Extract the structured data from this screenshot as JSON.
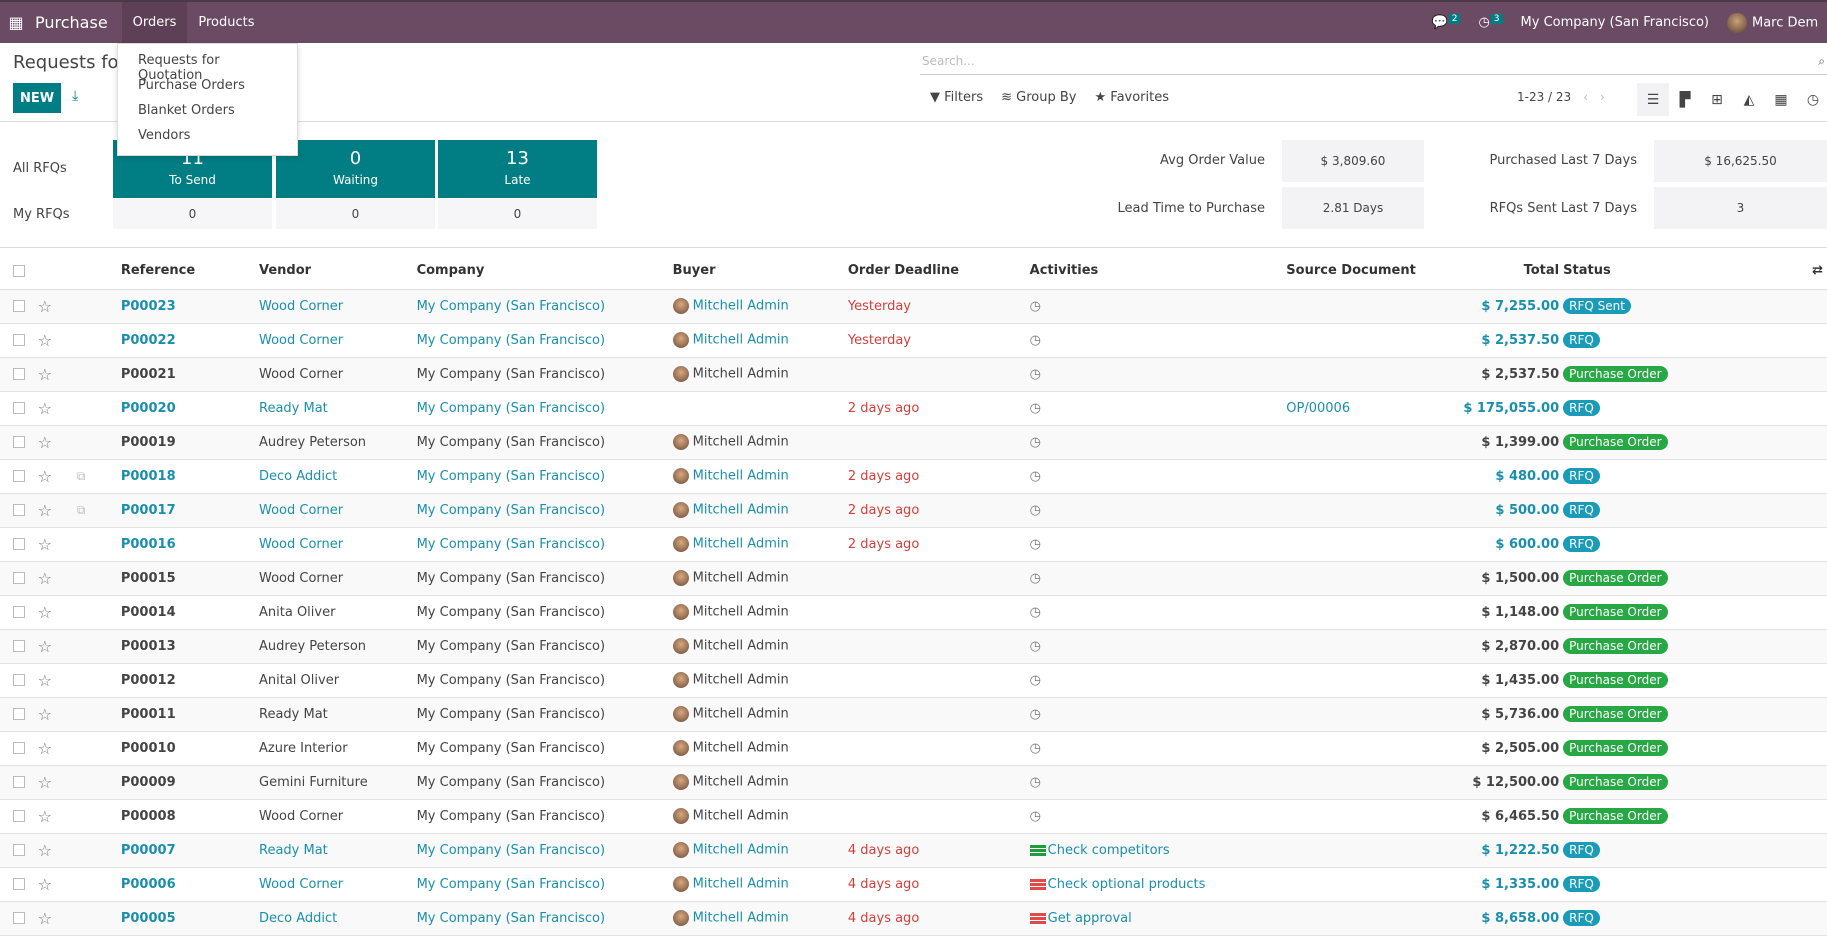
{
  "navbar": {
    "app_name": "Purchase",
    "menus": [
      "Orders",
      "Products"
    ],
    "messages_count": "2",
    "activities_count": "3",
    "company": "My Company (San Francisco)",
    "user": "Marc Dem"
  },
  "orders_menu": {
    "items": [
      "Requests for Quotation",
      "Purchase Orders",
      "Blanket Orders",
      "Vendors"
    ]
  },
  "page": {
    "title": "Requests for Quotation",
    "new_label": "NEW"
  },
  "search": {
    "placeholder": "Search...",
    "filters_label": "Filters",
    "group_by_label": "Group By",
    "favorites_label": "Favorites"
  },
  "pager": {
    "range": "1-23 / 23"
  },
  "views": [
    "list",
    "kanban",
    "pivot",
    "graph",
    "calendar",
    "activity"
  ],
  "dashboard": {
    "all_rfqs_label": "All RFQs",
    "my_rfqs_label": "My RFQs",
    "tiles": [
      {
        "count": "11",
        "label": "To Send",
        "mine": "0"
      },
      {
        "count": "0",
        "label": "Waiting",
        "mine": "0"
      },
      {
        "count": "13",
        "label": "Late",
        "mine": "0"
      }
    ],
    "kpis": [
      {
        "label": "Avg Order Value",
        "value": "$ 3,809.60"
      },
      {
        "label": "Purchased Last 7 Days",
        "value": "$ 16,625.50"
      },
      {
        "label": "Lead Time to Purchase",
        "value": "2.81 Days"
      },
      {
        "label": "RFQs Sent Last 7 Days",
        "value": "3"
      }
    ]
  },
  "table": {
    "columns": [
      "Reference",
      "Vendor",
      "Company",
      "Buyer",
      "Order Deadline",
      "Activities",
      "Source Document",
      "Total",
      "Status"
    ],
    "rows": [
      {
        "ref": "P00023",
        "vendor": "Wood Corner",
        "company": "My Company (San Francisco)",
        "buyer": "Mitchell Admin",
        "deadline": "Yesterday",
        "activity": "",
        "activity_color": "",
        "source": "",
        "total": "$ 7,255.00",
        "status": "RFQ Sent",
        "highlight": true,
        "copy": false
      },
      {
        "ref": "P00022",
        "vendor": "Wood Corner",
        "company": "My Company (San Francisco)",
        "buyer": "Mitchell Admin",
        "deadline": "Yesterday",
        "activity": "",
        "activity_color": "",
        "source": "",
        "total": "$ 2,537.50",
        "status": "RFQ",
        "highlight": true,
        "copy": false
      },
      {
        "ref": "P00021",
        "vendor": "Wood Corner",
        "company": "My Company (San Francisco)",
        "buyer": "Mitchell Admin",
        "deadline": "",
        "activity": "",
        "activity_color": "",
        "source": "",
        "total": "$ 2,537.50",
        "status": "Purchase Order",
        "highlight": false,
        "copy": false
      },
      {
        "ref": "P00020",
        "vendor": "Ready Mat",
        "company": "My Company (San Francisco)",
        "buyer": "",
        "deadline": "2 days ago",
        "activity": "",
        "activity_color": "",
        "source": "OP/00006",
        "total": "$ 175,055.00",
        "status": "RFQ",
        "highlight": true,
        "copy": false
      },
      {
        "ref": "P00019",
        "vendor": "Audrey Peterson",
        "company": "My Company (San Francisco)",
        "buyer": "Mitchell Admin",
        "deadline": "",
        "activity": "",
        "activity_color": "",
        "source": "",
        "total": "$ 1,399.00",
        "status": "Purchase Order",
        "highlight": false,
        "copy": false
      },
      {
        "ref": "P00018",
        "vendor": "Deco Addict",
        "company": "My Company (San Francisco)",
        "buyer": "Mitchell Admin",
        "deadline": "2 days ago",
        "activity": "",
        "activity_color": "",
        "source": "",
        "total": "$ 480.00",
        "status": "RFQ",
        "highlight": true,
        "copy": true
      },
      {
        "ref": "P00017",
        "vendor": "Wood Corner",
        "company": "My Company (San Francisco)",
        "buyer": "Mitchell Admin",
        "deadline": "2 days ago",
        "activity": "",
        "activity_color": "",
        "source": "",
        "total": "$ 500.00",
        "status": "RFQ",
        "highlight": true,
        "copy": true
      },
      {
        "ref": "P00016",
        "vendor": "Wood Corner",
        "company": "My Company (San Francisco)",
        "buyer": "Mitchell Admin",
        "deadline": "2 days ago",
        "activity": "",
        "activity_color": "",
        "source": "",
        "total": "$ 600.00",
        "status": "RFQ",
        "highlight": true,
        "copy": false
      },
      {
        "ref": "P00015",
        "vendor": "Wood Corner",
        "company": "My Company (San Francisco)",
        "buyer": "Mitchell Admin",
        "deadline": "",
        "activity": "",
        "activity_color": "",
        "source": "",
        "total": "$ 1,500.00",
        "status": "Purchase Order",
        "highlight": false,
        "copy": false
      },
      {
        "ref": "P00014",
        "vendor": "Anita Oliver",
        "company": "My Company (San Francisco)",
        "buyer": "Mitchell Admin",
        "deadline": "",
        "activity": "",
        "activity_color": "",
        "source": "",
        "total": "$ 1,148.00",
        "status": "Purchase Order",
        "highlight": false,
        "copy": false
      },
      {
        "ref": "P00013",
        "vendor": "Audrey Peterson",
        "company": "My Company (San Francisco)",
        "buyer": "Mitchell Admin",
        "deadline": "",
        "activity": "",
        "activity_color": "",
        "source": "",
        "total": "$ 2,870.00",
        "status": "Purchase Order",
        "highlight": false,
        "copy": false
      },
      {
        "ref": "P00012",
        "vendor": "Anital Oliver",
        "company": "My Company (San Francisco)",
        "buyer": "Mitchell Admin",
        "deadline": "",
        "activity": "",
        "activity_color": "",
        "source": "",
        "total": "$ 1,435.00",
        "status": "Purchase Order",
        "highlight": false,
        "copy": false
      },
      {
        "ref": "P00011",
        "vendor": "Ready Mat",
        "company": "My Company (San Francisco)",
        "buyer": "Mitchell Admin",
        "deadline": "",
        "activity": "",
        "activity_color": "",
        "source": "",
        "total": "$ 5,736.00",
        "status": "Purchase Order",
        "highlight": false,
        "copy": false
      },
      {
        "ref": "P00010",
        "vendor": "Azure Interior",
        "company": "My Company (San Francisco)",
        "buyer": "Mitchell Admin",
        "deadline": "",
        "activity": "",
        "activity_color": "",
        "source": "",
        "total": "$ 2,505.00",
        "status": "Purchase Order",
        "highlight": false,
        "copy": false
      },
      {
        "ref": "P00009",
        "vendor": "Gemini Furniture",
        "company": "My Company (San Francisco)",
        "buyer": "Mitchell Admin",
        "deadline": "",
        "activity": "",
        "activity_color": "",
        "source": "",
        "total": "$ 12,500.00",
        "status": "Purchase Order",
        "highlight": false,
        "copy": false
      },
      {
        "ref": "P00008",
        "vendor": "Wood Corner",
        "company": "My Company (San Francisco)",
        "buyer": "Mitchell Admin",
        "deadline": "",
        "activity": "",
        "activity_color": "",
        "source": "",
        "total": "$ 6,465.50",
        "status": "Purchase Order",
        "highlight": false,
        "copy": false
      },
      {
        "ref": "P00007",
        "vendor": "Ready Mat",
        "company": "My Company (San Francisco)",
        "buyer": "Mitchell Admin",
        "deadline": "4 days ago",
        "activity": "Check competitors",
        "activity_color": "green",
        "source": "",
        "total": "$ 1,222.50",
        "status": "RFQ",
        "highlight": true,
        "copy": false
      },
      {
        "ref": "P00006",
        "vendor": "Wood Corner",
        "company": "My Company (San Francisco)",
        "buyer": "Mitchell Admin",
        "deadline": "4 days ago",
        "activity": "Check optional products",
        "activity_color": "red",
        "source": "",
        "total": "$ 1,335.00",
        "status": "RFQ",
        "highlight": true,
        "copy": false
      },
      {
        "ref": "P00005",
        "vendor": "Deco Addict",
        "company": "My Company (San Francisco)",
        "buyer": "Mitchell Admin",
        "deadline": "4 days ago",
        "activity": "Get approval",
        "activity_color": "red",
        "source": "",
        "total": "$ 8,658.00",
        "status": "RFQ",
        "highlight": true,
        "copy": false
      }
    ]
  },
  "colors": {
    "navbar": "#6b4a63",
    "primary": "#017e84",
    "link": "#1a8fab",
    "danger": "#d23f3a",
    "status_rfq": "#1a9bb8",
    "status_po": "#28a745"
  }
}
